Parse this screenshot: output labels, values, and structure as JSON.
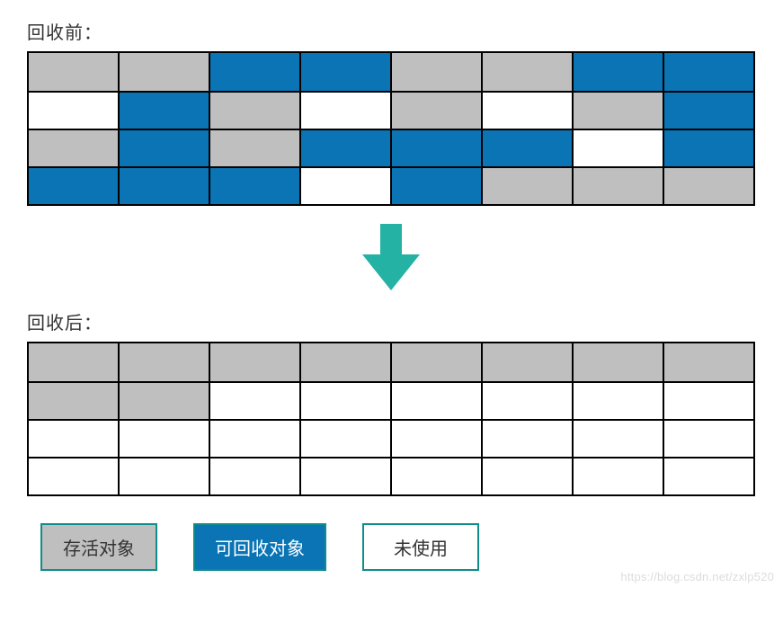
{
  "labels": {
    "before": "回收前：",
    "after": "回收后：",
    "legend_survive": "存活对象",
    "legend_recycle": "可回收对象",
    "legend_unused": "未使用"
  },
  "colors": {
    "survive": "#bfbfbf",
    "recycle": "#0a74b5",
    "unused": "#ffffff",
    "arrow": "#23b2a4",
    "legend_border": "#0e8d8a"
  },
  "chart_data": {
    "type": "table",
    "title": "内存回收前后对比 (Memory Before/After GC)",
    "cell_states": {
      "surv": "存活对象",
      "recy": "可回收对象",
      "unus": "未使用"
    },
    "cols": 8,
    "rows_per_grid": 4,
    "before_grid": [
      [
        "surv",
        "surv",
        "recy",
        "recy",
        "surv",
        "surv",
        "recy",
        "recy"
      ],
      [
        "unus",
        "recy",
        "surv",
        "unus",
        "surv",
        "unus",
        "surv",
        "recy"
      ],
      [
        "surv",
        "recy",
        "surv",
        "recy",
        "recy",
        "recy",
        "unus",
        "recy"
      ],
      [
        "recy",
        "recy",
        "recy",
        "unus",
        "recy",
        "surv",
        "surv",
        "surv"
      ]
    ],
    "after_grid": [
      [
        "surv",
        "surv",
        "surv",
        "surv",
        "surv",
        "surv",
        "surv",
        "surv"
      ],
      [
        "surv",
        "surv",
        "unus",
        "unus",
        "unus",
        "unus",
        "unus",
        "unus"
      ],
      [
        "unus",
        "unus",
        "unus",
        "unus",
        "unus",
        "unus",
        "unus",
        "unus"
      ],
      [
        "unus",
        "unus",
        "unus",
        "unus",
        "unus",
        "unus",
        "unus",
        "unus"
      ]
    ]
  },
  "watermark": "https://blog.csdn.net/zxlp520"
}
